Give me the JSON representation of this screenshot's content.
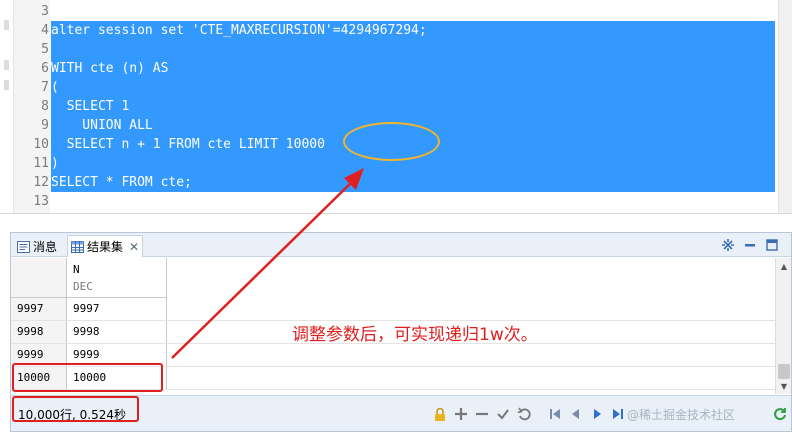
{
  "editor": {
    "lines": [
      {
        "n": "3",
        "code": "",
        "selected": false
      },
      {
        "n": "4",
        "code": "alter session set 'CTE_MAXRECURSION'=4294967294;",
        "selected": true
      },
      {
        "n": "5",
        "code": "",
        "selected": true
      },
      {
        "n": "6",
        "code": "WITH cte (n) AS",
        "selected": true
      },
      {
        "n": "7",
        "code": "(",
        "selected": true
      },
      {
        "n": "8",
        "code": "  SELECT 1",
        "selected": true
      },
      {
        "n": "9",
        "code": "    UNION ALL",
        "selected": true
      },
      {
        "n": "10",
        "code": "  SELECT n + 1 FROM cte LIMIT 10000",
        "selected": true
      },
      {
        "n": "11",
        "code": ")",
        "selected": true
      },
      {
        "n": "12",
        "code": "SELECT * FROM cte;",
        "selected": true
      },
      {
        "n": "13",
        "code": "",
        "selected": false
      }
    ],
    "selection_color": "#3399ff"
  },
  "result_panel": {
    "tabs": [
      {
        "label": "消息",
        "icon": "message-icon",
        "active": false
      },
      {
        "label": "结果集",
        "icon": "table-grid-icon",
        "active": true
      }
    ],
    "grid": {
      "column": {
        "name": "N",
        "type": "DEC"
      },
      "rows": [
        {
          "rownum": "9997",
          "value": "9997"
        },
        {
          "rownum": "9998",
          "value": "9998"
        },
        {
          "rownum": "9999",
          "value": "9999"
        },
        {
          "rownum": "10000",
          "value": "10000"
        }
      ]
    },
    "status": {
      "text": "10,000行, 0.524秒"
    },
    "toolbar_icons": [
      "lock-icon",
      "add-row-icon",
      "delete-row-icon",
      "apply-icon",
      "revert-icon",
      "first-page-icon",
      "prev-page-icon",
      "next-page-icon",
      "last-page-icon",
      "refresh-icon"
    ],
    "watermark": "@稀土掘金技术社区"
  },
  "annotation": {
    "text": "调整参数后，可实现递归1w次。",
    "highlight_color": "#e02020",
    "green_box_color": "#3dae3d",
    "ellipse_color": "#f0b42d"
  }
}
